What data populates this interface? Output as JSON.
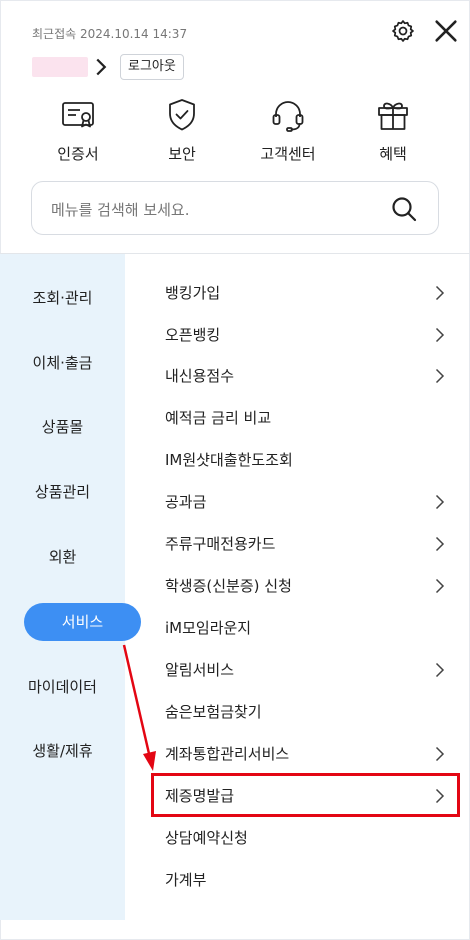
{
  "header": {
    "last_login": "최근접속 2024.10.14 14:37",
    "logout_label": "로그아웃",
    "icons": {
      "settings": "gear-icon",
      "close": "close-icon"
    }
  },
  "quick_menu": [
    {
      "label": "인증서",
      "icon": "certificate-icon"
    },
    {
      "label": "보안",
      "icon": "shield-check-icon"
    },
    {
      "label": "고객센터",
      "icon": "headset-icon"
    },
    {
      "label": "혜택",
      "icon": "gift-icon"
    }
  ],
  "search": {
    "placeholder": "메뉴를 검색해 보세요."
  },
  "sidebar": {
    "items": [
      {
        "label": "조회·관리"
      },
      {
        "label": "이체·출금"
      },
      {
        "label": "상품몰"
      },
      {
        "label": "상품관리"
      },
      {
        "label": "외환"
      },
      {
        "label": "서비스",
        "active": true
      },
      {
        "label": "마이데이터"
      },
      {
        "label": "생활/제휴"
      }
    ]
  },
  "menu": {
    "items": [
      {
        "label": "뱅킹가입",
        "chevron": true
      },
      {
        "label": "오픈뱅킹",
        "chevron": true
      },
      {
        "label": "내신용점수",
        "chevron": true
      },
      {
        "label": "예적금 금리 비교",
        "chevron": false
      },
      {
        "label": "IM원샷대출한도조회",
        "chevron": false
      },
      {
        "label": "공과금",
        "chevron": true
      },
      {
        "label": "주류구매전용카드",
        "chevron": true
      },
      {
        "label": "학생증(신분증) 신청",
        "chevron": true
      },
      {
        "label": "iM모임라운지",
        "chevron": false
      },
      {
        "label": "알림서비스",
        "chevron": true
      },
      {
        "label": "숨은보험금찾기",
        "chevron": false
      },
      {
        "label": "계좌통합관리서비스",
        "chevron": true
      },
      {
        "label": "제증명발급",
        "chevron": true,
        "highlighted": true
      },
      {
        "label": "상담예약신청",
        "chevron": false
      },
      {
        "label": "가계부",
        "chevron": false
      }
    ]
  },
  "annotation": {
    "highlight_color": "#e30613",
    "accent_color": "#3d8ff3"
  }
}
